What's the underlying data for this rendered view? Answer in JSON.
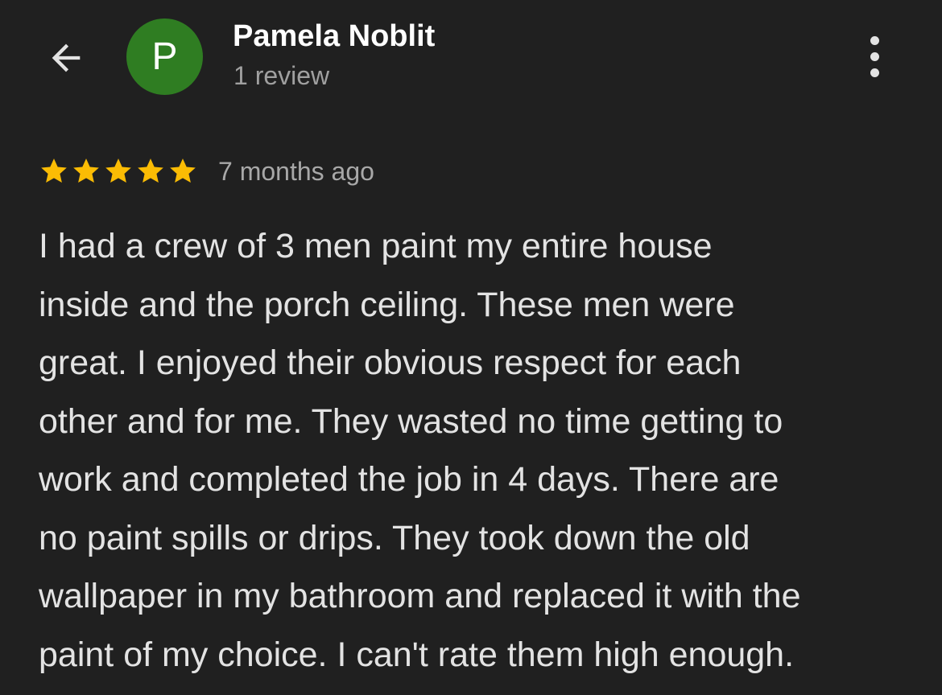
{
  "header": {
    "back_icon": "arrow-back-icon",
    "avatar_letter": "P",
    "avatar_color": "#2f7d22",
    "reviewer_name": "Pamela Noblit",
    "review_count": "1 review",
    "more_icon": "more-vert-icon"
  },
  "review": {
    "rating": 5,
    "max_rating": 5,
    "star_color": "#fbbc04",
    "time_ago": "7 months ago",
    "lines": [
      "I had a crew of 3 men paint my entire house",
      "inside and the porch ceiling. These men were",
      "great. I enjoyed their obvious respect for each",
      "other and for me. They wasted no time getting to",
      "work and completed the job in 4 days. There are",
      "no paint spills or drips. They took down the old",
      "wallpaper in my bathroom and replaced it with the",
      "paint of my choice. I can't rate them high enough."
    ]
  }
}
